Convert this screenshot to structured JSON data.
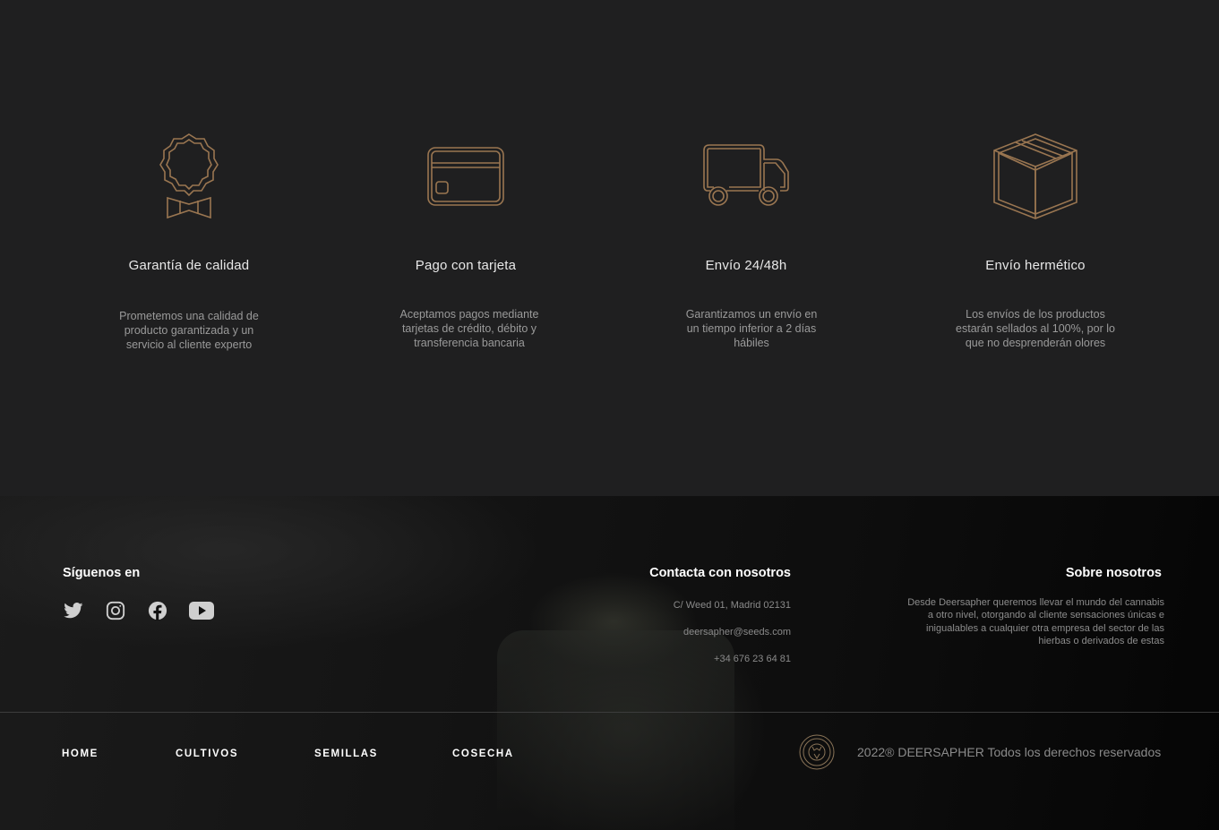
{
  "features": [
    {
      "icon": "badge-icon",
      "title": "Garantía de calidad",
      "desc": "Prometemos una calidad de producto garantizada y un servicio al cliente experto"
    },
    {
      "icon": "credit-card-icon",
      "title": "Pago con tarjeta",
      "desc": "Aceptamos pagos mediante tarjetas de crédito, débito y transferencia bancaria"
    },
    {
      "icon": "truck-icon",
      "title": "Envío 24/48h",
      "desc": "Garantizamos un envío en un tiempo inferior a 2 días hábiles"
    },
    {
      "icon": "box-icon",
      "title": "Envío hermético",
      "desc": "Los envíos de los productos estarán sellados al 100%, por lo que no desprenderán olores"
    }
  ],
  "footer": {
    "social_heading": "Síguenos en",
    "social_icons": [
      "twitter-icon",
      "instagram-icon",
      "facebook-icon",
      "youtube-icon"
    ],
    "contact_heading": "Contacta con nosotros",
    "address": "C/ Weed 01, Madrid 02131",
    "email": "deersapher@seeds.com",
    "phone": "+34 676 23 64 81",
    "about_heading": "Sobre nosotros",
    "about_text": "Desde Deersapher queremos llevar el mundo del cannabis a otro nivel, otorgando al cliente sensaciones únicas e inigualables a cualquier otra empresa del sector de las hierbas o derivados de estas",
    "nav": [
      "HOME",
      "CULTIVOS",
      "SEMILLAS",
      "COSECHA"
    ],
    "copyright": "2022® DEERSAPHER Todos los derechos reservados"
  },
  "colors": {
    "accent": "#9a7651",
    "background": "#1f1f20"
  }
}
